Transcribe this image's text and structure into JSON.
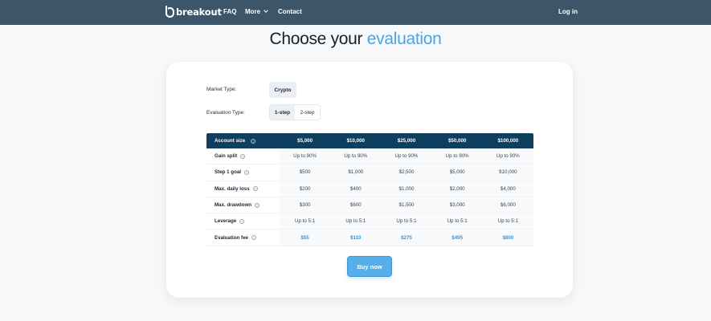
{
  "brand": {
    "name": "breakout"
  },
  "nav": {
    "faq": "FAQ",
    "more": "More",
    "contact": "Contact",
    "login": "Log in"
  },
  "page": {
    "title_main": "Choose your",
    "title_accent": "evaluation"
  },
  "options": {
    "market_type_label": "Market Type:",
    "market_type_value": "Crypto",
    "evaluation_type_label": "Evaluation Type:",
    "evaluation_types": [
      "1-step",
      "2-step"
    ],
    "evaluation_type_selected": "1-step"
  },
  "table": {
    "header": {
      "label": "Account size",
      "sizes": [
        "$5,000",
        "$10,000",
        "$25,000",
        "$50,000",
        "$100,000"
      ]
    },
    "rows": [
      {
        "label": "Gain split",
        "values": [
          "Up to 90%",
          "Up to 90%",
          "Up to 90%",
          "Up to 90%",
          "Up to 90%"
        ]
      },
      {
        "label": "Step 1 goal",
        "values": [
          "$500",
          "$1,000",
          "$2,500",
          "$5,000",
          "$10,000"
        ]
      },
      {
        "label": "Max. daily loss",
        "values": [
          "$200",
          "$400",
          "$1,000",
          "$2,000",
          "$4,000"
        ]
      },
      {
        "label": "Max. drawdown",
        "values": [
          "$300",
          "$600",
          "$1,500",
          "$3,000",
          "$6,000"
        ]
      },
      {
        "label": "Leverage",
        "values": [
          "Up to 5:1",
          "Up to 5:1",
          "Up to 5:1",
          "Up to 5:1",
          "Up to 5:1"
        ]
      },
      {
        "label": "Evaluation fee",
        "values": [
          "$55",
          "$110",
          "$275",
          "$495",
          "$800"
        ]
      }
    ]
  },
  "cta": {
    "buy_label": "Buy now"
  },
  "colors": {
    "nav_bg": "#3c5569",
    "table_header_bg": "#0f3f5f",
    "accent": "#4ea4e0",
    "fee_text": "#2f9ae0",
    "button_bg": "#56aeea"
  }
}
